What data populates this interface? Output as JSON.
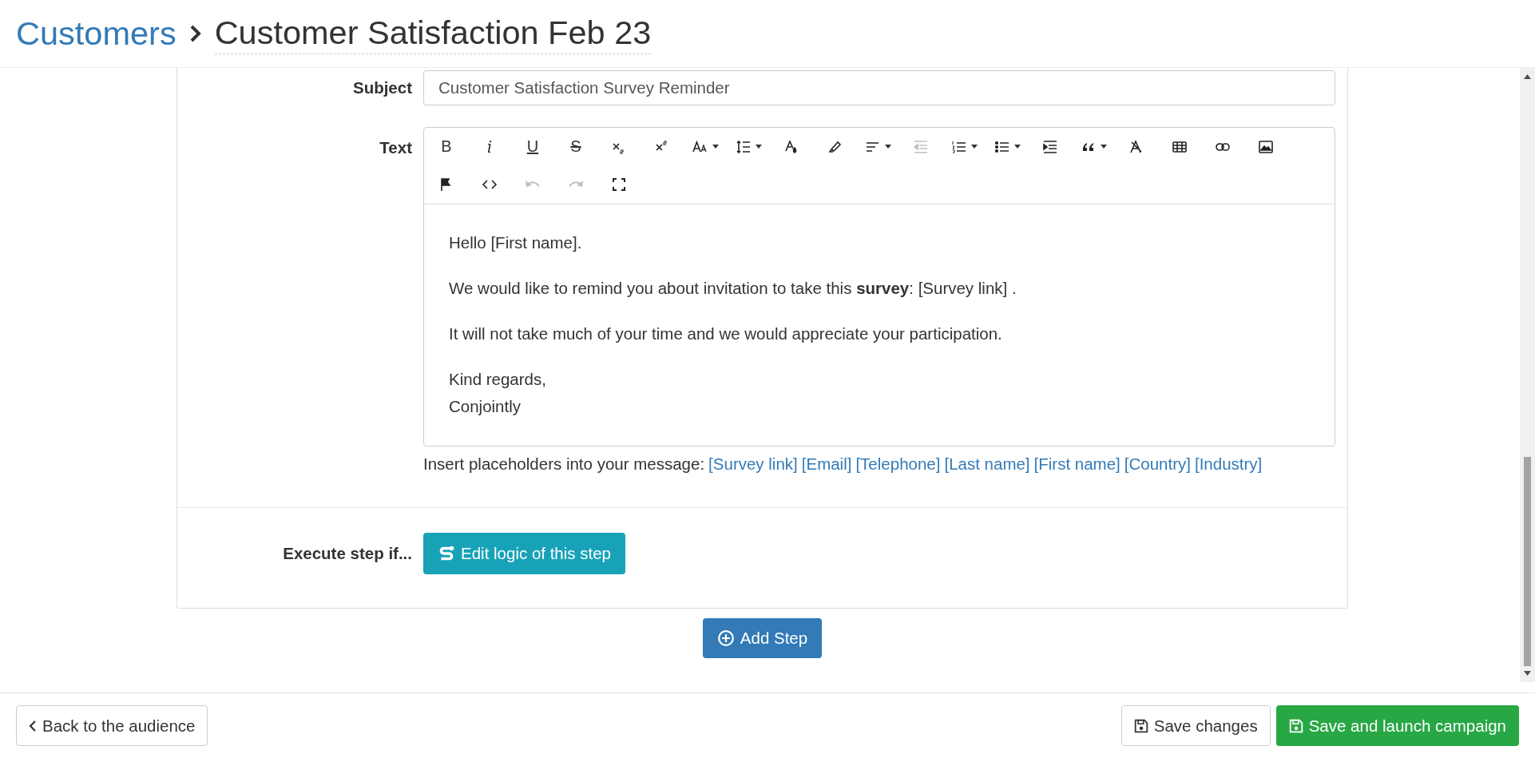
{
  "breadcrumb": {
    "parent": "Customers",
    "title": "Customer Satisfaction Feb 23"
  },
  "step": {
    "subject": {
      "label": "Subject",
      "value": "Customer Satisfaction Survey Reminder"
    },
    "text": {
      "label": "Text",
      "toolbar": [
        [
          {
            "kind": "bold",
            "glyph": "B",
            "dropdown": false,
            "disabled": false
          },
          {
            "kind": "italic",
            "glyph": "i",
            "dropdown": false,
            "disabled": false
          },
          {
            "kind": "underline",
            "glyph": "U",
            "dropdown": false,
            "disabled": false
          },
          {
            "kind": "strikethrough",
            "glyph": "S",
            "dropdown": false,
            "disabled": false
          },
          {
            "kind": "subscript",
            "dropdown": false,
            "disabled": false
          },
          {
            "kind": "superscript",
            "dropdown": false,
            "disabled": false
          },
          {
            "kind": "font-size",
            "dropdown": true,
            "disabled": false
          },
          {
            "kind": "line-height",
            "dropdown": true,
            "disabled": false
          },
          {
            "kind": "text-color",
            "dropdown": false,
            "disabled": false
          },
          {
            "kind": "highlight",
            "dropdown": false,
            "disabled": false
          },
          {
            "kind": "align",
            "dropdown": true,
            "disabled": false
          },
          {
            "kind": "outdent",
            "dropdown": false,
            "disabled": true
          },
          {
            "kind": "ordered-list",
            "dropdown": true,
            "disabled": false
          },
          {
            "kind": "bullet-list",
            "dropdown": true,
            "disabled": false
          },
          {
            "kind": "indent",
            "dropdown": false,
            "disabled": false
          },
          {
            "kind": "quote",
            "dropdown": true,
            "disabled": false
          },
          {
            "kind": "clear-format",
            "dropdown": false,
            "disabled": false
          },
          {
            "kind": "table",
            "dropdown": false,
            "disabled": false
          },
          {
            "kind": "link",
            "dropdown": false,
            "disabled": false
          },
          {
            "kind": "image",
            "dropdown": false,
            "disabled": false
          }
        ],
        [
          {
            "kind": "flag",
            "dropdown": false,
            "disabled": false
          },
          {
            "kind": "code",
            "dropdown": false,
            "disabled": false
          },
          {
            "kind": "undo",
            "dropdown": false,
            "disabled": true
          },
          {
            "kind": "redo",
            "dropdown": false,
            "disabled": true
          },
          {
            "kind": "fullscreen",
            "dropdown": false,
            "disabled": false
          }
        ]
      ],
      "paragraphs": [
        [
          "Hello [First name]."
        ],
        [
          "We would like to remind you about invitation to take this **survey**: [Survey link] ."
        ],
        [
          "It will not take much of your time and we would appreciate your participation."
        ],
        [
          "Kind regards,",
          "Conjointly"
        ]
      ],
      "placeholder_hint": "Insert placeholders into your message:",
      "placeholders": [
        "[Survey link]",
        "[Email]",
        "[Telephone]",
        "[Last name]",
        "[First name]",
        "[Country]",
        "[Industry]"
      ]
    },
    "condition": {
      "label": "Execute step if...",
      "button": "Edit logic of this step"
    }
  },
  "add_step": "Add Step",
  "footer": {
    "back": "Back to the audience",
    "save": "Save changes",
    "launch": "Save and launch campaign"
  }
}
